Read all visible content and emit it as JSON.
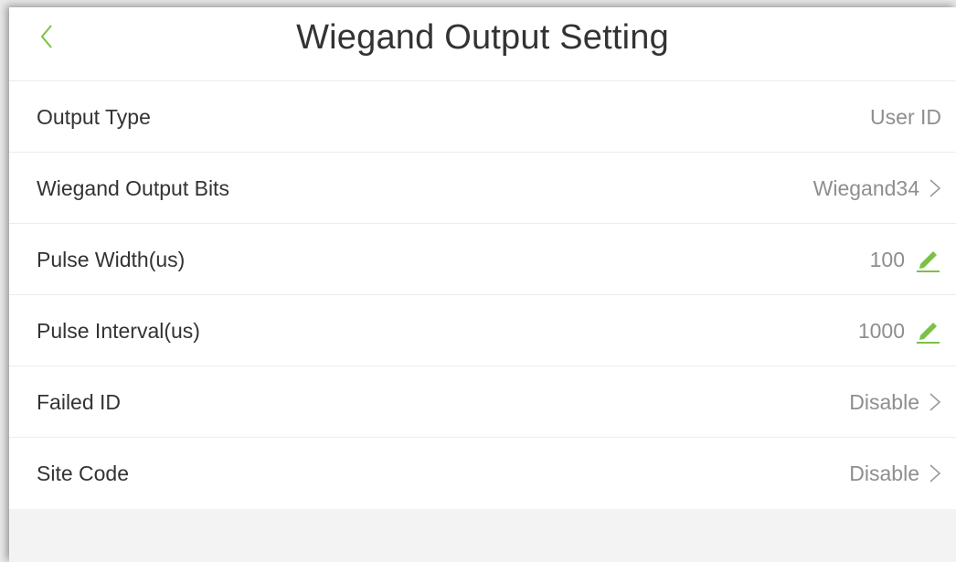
{
  "header": {
    "title": "Wiegand Output Setting",
    "back_icon": "chevron-left-icon"
  },
  "settings": [
    {
      "label": "Output Type",
      "value": "User ID",
      "action": "none"
    },
    {
      "label": "Wiegand Output Bits",
      "value": "Wiegand34",
      "action": "chevron-right-icon"
    },
    {
      "label": "Pulse Width(us)",
      "value": "100",
      "action": "pencil-icon"
    },
    {
      "label": "Pulse Interval(us)",
      "value": "1000",
      "action": "pencil-icon"
    },
    {
      "label": "Failed ID",
      "value": "Disable",
      "action": "chevron-right-icon"
    },
    {
      "label": "Site Code",
      "value": "Disable",
      "action": "chevron-right-icon"
    }
  ],
  "colors": {
    "accent": "#7bc144",
    "text": "#333333",
    "value_text": "#8e8e8e",
    "background": "#f3f3f3"
  }
}
